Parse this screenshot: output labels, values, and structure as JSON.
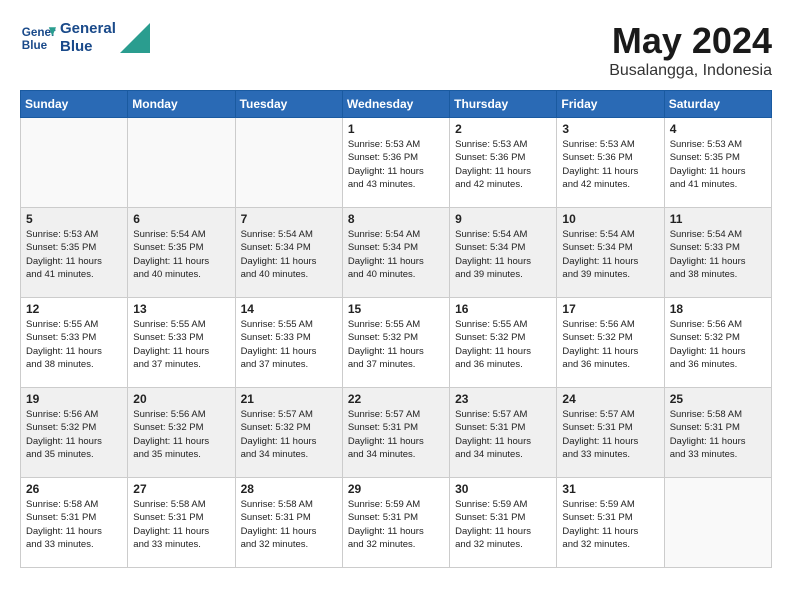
{
  "header": {
    "logo_line1": "General",
    "logo_line2": "Blue",
    "month": "May 2024",
    "location": "Busalangga, Indonesia"
  },
  "days_of_week": [
    "Sunday",
    "Monday",
    "Tuesday",
    "Wednesday",
    "Thursday",
    "Friday",
    "Saturday"
  ],
  "weeks": [
    [
      {
        "day": "",
        "info": ""
      },
      {
        "day": "",
        "info": ""
      },
      {
        "day": "",
        "info": ""
      },
      {
        "day": "1",
        "info": "Sunrise: 5:53 AM\nSunset: 5:36 PM\nDaylight: 11 hours\nand 43 minutes."
      },
      {
        "day": "2",
        "info": "Sunrise: 5:53 AM\nSunset: 5:36 PM\nDaylight: 11 hours\nand 42 minutes."
      },
      {
        "day": "3",
        "info": "Sunrise: 5:53 AM\nSunset: 5:36 PM\nDaylight: 11 hours\nand 42 minutes."
      },
      {
        "day": "4",
        "info": "Sunrise: 5:53 AM\nSunset: 5:35 PM\nDaylight: 11 hours\nand 41 minutes."
      }
    ],
    [
      {
        "day": "5",
        "info": "Sunrise: 5:53 AM\nSunset: 5:35 PM\nDaylight: 11 hours\nand 41 minutes."
      },
      {
        "day": "6",
        "info": "Sunrise: 5:54 AM\nSunset: 5:35 PM\nDaylight: 11 hours\nand 40 minutes."
      },
      {
        "day": "7",
        "info": "Sunrise: 5:54 AM\nSunset: 5:34 PM\nDaylight: 11 hours\nand 40 minutes."
      },
      {
        "day": "8",
        "info": "Sunrise: 5:54 AM\nSunset: 5:34 PM\nDaylight: 11 hours\nand 40 minutes."
      },
      {
        "day": "9",
        "info": "Sunrise: 5:54 AM\nSunset: 5:34 PM\nDaylight: 11 hours\nand 39 minutes."
      },
      {
        "day": "10",
        "info": "Sunrise: 5:54 AM\nSunset: 5:34 PM\nDaylight: 11 hours\nand 39 minutes."
      },
      {
        "day": "11",
        "info": "Sunrise: 5:54 AM\nSunset: 5:33 PM\nDaylight: 11 hours\nand 38 minutes."
      }
    ],
    [
      {
        "day": "12",
        "info": "Sunrise: 5:55 AM\nSunset: 5:33 PM\nDaylight: 11 hours\nand 38 minutes."
      },
      {
        "day": "13",
        "info": "Sunrise: 5:55 AM\nSunset: 5:33 PM\nDaylight: 11 hours\nand 37 minutes."
      },
      {
        "day": "14",
        "info": "Sunrise: 5:55 AM\nSunset: 5:33 PM\nDaylight: 11 hours\nand 37 minutes."
      },
      {
        "day": "15",
        "info": "Sunrise: 5:55 AM\nSunset: 5:32 PM\nDaylight: 11 hours\nand 37 minutes."
      },
      {
        "day": "16",
        "info": "Sunrise: 5:55 AM\nSunset: 5:32 PM\nDaylight: 11 hours\nand 36 minutes."
      },
      {
        "day": "17",
        "info": "Sunrise: 5:56 AM\nSunset: 5:32 PM\nDaylight: 11 hours\nand 36 minutes."
      },
      {
        "day": "18",
        "info": "Sunrise: 5:56 AM\nSunset: 5:32 PM\nDaylight: 11 hours\nand 36 minutes."
      }
    ],
    [
      {
        "day": "19",
        "info": "Sunrise: 5:56 AM\nSunset: 5:32 PM\nDaylight: 11 hours\nand 35 minutes."
      },
      {
        "day": "20",
        "info": "Sunrise: 5:56 AM\nSunset: 5:32 PM\nDaylight: 11 hours\nand 35 minutes."
      },
      {
        "day": "21",
        "info": "Sunrise: 5:57 AM\nSunset: 5:32 PM\nDaylight: 11 hours\nand 34 minutes."
      },
      {
        "day": "22",
        "info": "Sunrise: 5:57 AM\nSunset: 5:31 PM\nDaylight: 11 hours\nand 34 minutes."
      },
      {
        "day": "23",
        "info": "Sunrise: 5:57 AM\nSunset: 5:31 PM\nDaylight: 11 hours\nand 34 minutes."
      },
      {
        "day": "24",
        "info": "Sunrise: 5:57 AM\nSunset: 5:31 PM\nDaylight: 11 hours\nand 33 minutes."
      },
      {
        "day": "25",
        "info": "Sunrise: 5:58 AM\nSunset: 5:31 PM\nDaylight: 11 hours\nand 33 minutes."
      }
    ],
    [
      {
        "day": "26",
        "info": "Sunrise: 5:58 AM\nSunset: 5:31 PM\nDaylight: 11 hours\nand 33 minutes."
      },
      {
        "day": "27",
        "info": "Sunrise: 5:58 AM\nSunset: 5:31 PM\nDaylight: 11 hours\nand 33 minutes."
      },
      {
        "day": "28",
        "info": "Sunrise: 5:58 AM\nSunset: 5:31 PM\nDaylight: 11 hours\nand 32 minutes."
      },
      {
        "day": "29",
        "info": "Sunrise: 5:59 AM\nSunset: 5:31 PM\nDaylight: 11 hours\nand 32 minutes."
      },
      {
        "day": "30",
        "info": "Sunrise: 5:59 AM\nSunset: 5:31 PM\nDaylight: 11 hours\nand 32 minutes."
      },
      {
        "day": "31",
        "info": "Sunrise: 5:59 AM\nSunset: 5:31 PM\nDaylight: 11 hours\nand 32 minutes."
      },
      {
        "day": "",
        "info": ""
      }
    ]
  ]
}
